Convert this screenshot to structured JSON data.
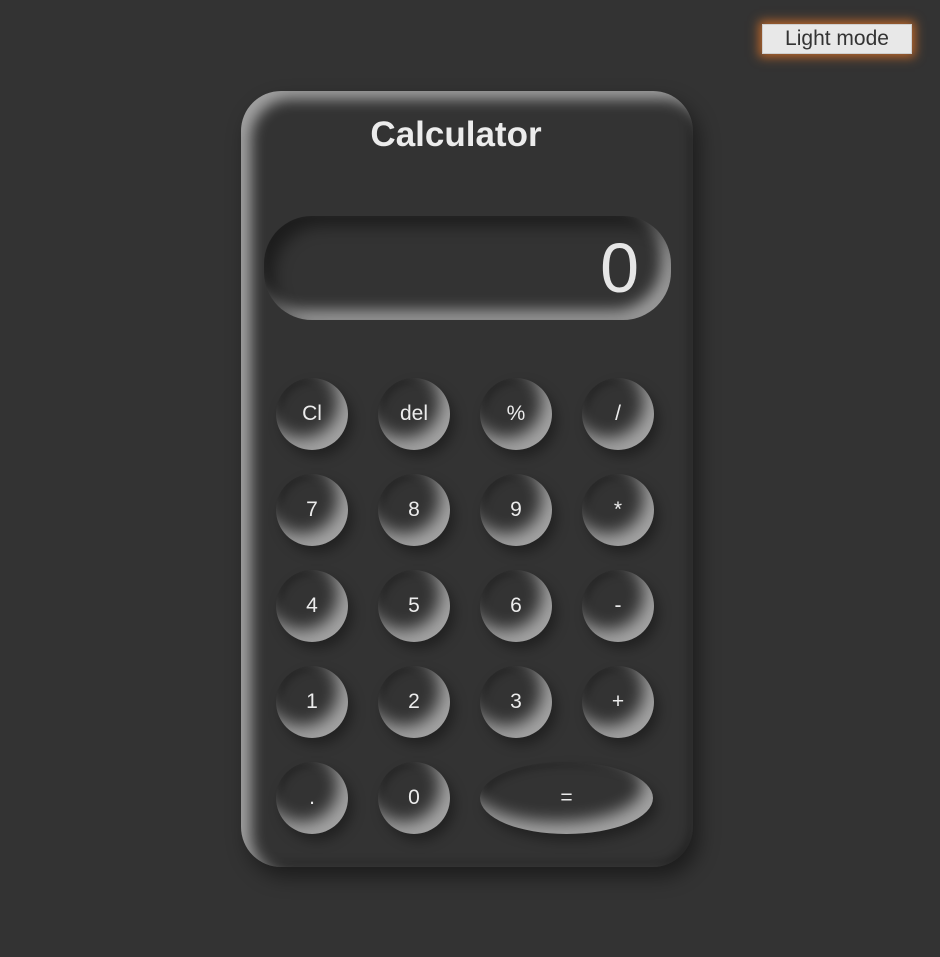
{
  "theme_toggle": {
    "label": "Light mode"
  },
  "calculator": {
    "title": "Calculator",
    "display": "0",
    "keys": {
      "clear": "Cl",
      "delete": "del",
      "percent": "%",
      "divide": "/",
      "seven": "7",
      "eight": "8",
      "nine": "9",
      "multiply": "*",
      "four": "4",
      "five": "5",
      "six": "6",
      "subtract": "-",
      "one": "1",
      "two": "2",
      "three": "3",
      "add": "+",
      "decimal": ".",
      "zero": "0",
      "equals": "="
    }
  },
  "colors": {
    "background": "#333333",
    "text": "#ececec",
    "toggle_glow": "#e87828"
  }
}
